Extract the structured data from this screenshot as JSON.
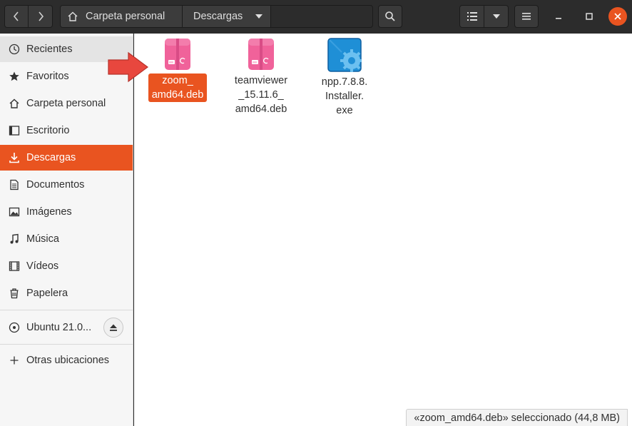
{
  "header": {
    "path": [
      {
        "label": "Carpeta personal",
        "icon": "home-icon"
      },
      {
        "label": "Descargas",
        "icon": "chevron-down-icon"
      }
    ]
  },
  "sidebar": {
    "items": [
      {
        "label": "Recientes",
        "icon": "clock-icon",
        "state": "hover"
      },
      {
        "label": "Favoritos",
        "icon": "star-icon"
      },
      {
        "label": "Carpeta personal",
        "icon": "home-icon"
      },
      {
        "label": "Escritorio",
        "icon": "desktop-icon"
      },
      {
        "label": "Descargas",
        "icon": "download-icon",
        "state": "active"
      },
      {
        "label": "Documentos",
        "icon": "document-icon"
      },
      {
        "label": "Imágenes",
        "icon": "image-icon"
      },
      {
        "label": "Música",
        "icon": "music-icon"
      },
      {
        "label": "Vídeos",
        "icon": "video-icon"
      },
      {
        "label": "Papelera",
        "icon": "trash-icon"
      }
    ],
    "device": {
      "label": "Ubuntu 21.0...",
      "icon": "disc-icon"
    },
    "other": {
      "label": "Otras ubicaciones",
      "icon": "plus-icon"
    }
  },
  "files": [
    {
      "name": "zoom_\namd64.deb",
      "type": "deb",
      "selected": true
    },
    {
      "name": "teamviewer\n_15.11.6_\namd64.deb",
      "type": "deb"
    },
    {
      "name": "npp.7.8.8.\nInstaller.\nexe",
      "type": "exe"
    }
  ],
  "status": {
    "text": "«zoom_amd64.deb» seleccionado  (44,8 MB)"
  },
  "colors": {
    "accent": "#e95420",
    "header": "#2c2c2c",
    "deb": "#f0629a",
    "exe": "#1f8fd6",
    "arrow": "#e8473e"
  }
}
